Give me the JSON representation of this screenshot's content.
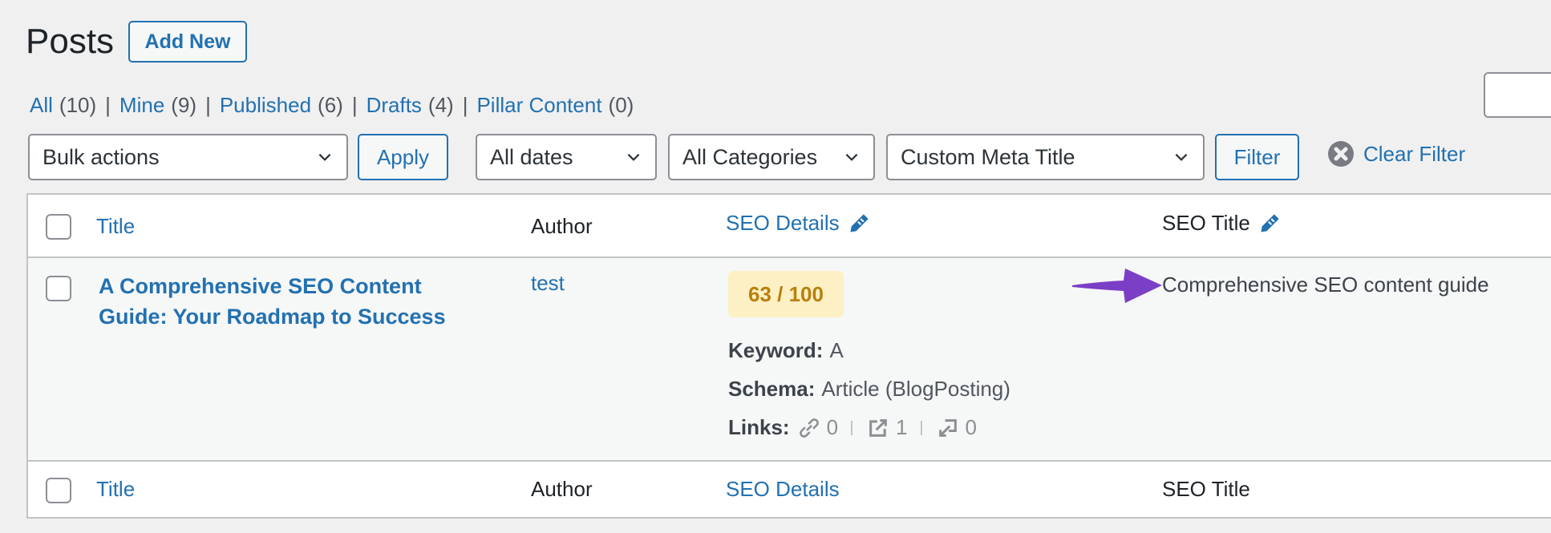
{
  "header": {
    "title": "Posts",
    "add_new_label": "Add New"
  },
  "status_filters": [
    {
      "label": "All",
      "count": "(10)"
    },
    {
      "label": "Mine",
      "count": "(9)"
    },
    {
      "label": "Published",
      "count": "(6)"
    },
    {
      "label": "Drafts",
      "count": "(4)"
    },
    {
      "label": "Pillar Content",
      "count": "(0)"
    }
  ],
  "separator": "|",
  "toolbar": {
    "bulk_actions": "Bulk actions",
    "apply_label": "Apply",
    "dates": "All dates",
    "categories": "All Categories",
    "seo_filter": "Custom Meta Title",
    "filter_label": "Filter",
    "clear_filter_label": "Clear Filter"
  },
  "table": {
    "columns": {
      "title": "Title",
      "author": "Author",
      "seo_details": "SEO Details",
      "seo_title": "SEO Title"
    },
    "rows": [
      {
        "title": "A Comprehensive SEO Content Guide: Your Roadmap to Success",
        "author": "test",
        "seo_score": "63 / 100",
        "keyword_label": "Keyword:",
        "keyword": "A",
        "schema_label": "Schema:",
        "schema": "Article (BlogPosting)",
        "links_label": "Links:",
        "internal_links": "0",
        "external_links": "1",
        "incoming_links": "0",
        "seo_title": "Comprehensive SEO content guide"
      }
    ]
  },
  "colors": {
    "accent": "#2271b1",
    "score_bg": "#fdf0c4",
    "score_text": "#b7800e",
    "annotation_arrow": "#7b3fc6"
  }
}
